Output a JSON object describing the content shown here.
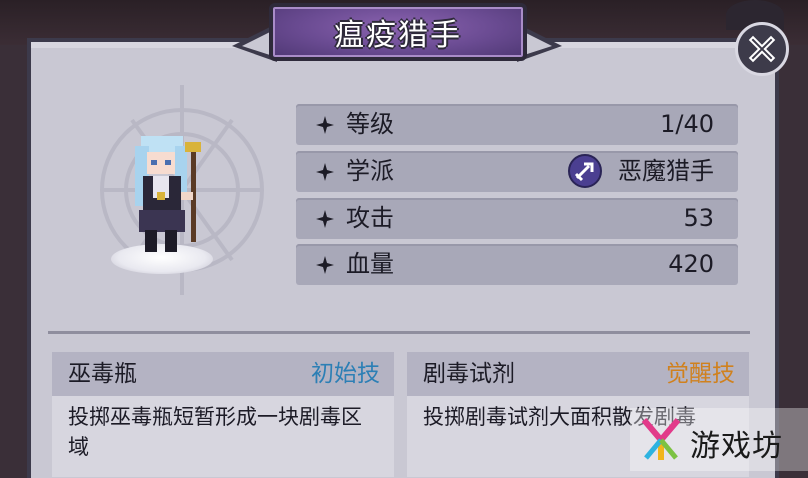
{
  "title": "瘟疫猎手",
  "stats": [
    {
      "label": "等级",
      "value": "1/40"
    },
    {
      "label": "学派",
      "value": "恶魔猎手"
    },
    {
      "label": "攻击",
      "value": "53"
    },
    {
      "label": "血量",
      "value": "420"
    }
  ],
  "skills": [
    {
      "name": "巫毒瓶",
      "tag": "初始技",
      "tag_color": "#2c7fb5",
      "desc": "投掷巫毒瓶短暂形成一块剧毒区域"
    },
    {
      "name": "剧毒试剂",
      "tag": "觉醒技",
      "tag_color": "#d0811e",
      "desc": "投掷剧毒试剂大面积散发剧毒"
    }
  ],
  "watermark": {
    "text": "游戏坊"
  },
  "colors": {
    "panel": "#c9c8d3",
    "stat_row": "#a8a8b8",
    "title_plate": "#6a4b92"
  },
  "icons": {
    "close": "close-icon",
    "row": "sparkle-icon",
    "school": "demon-hunter-school-icon"
  }
}
